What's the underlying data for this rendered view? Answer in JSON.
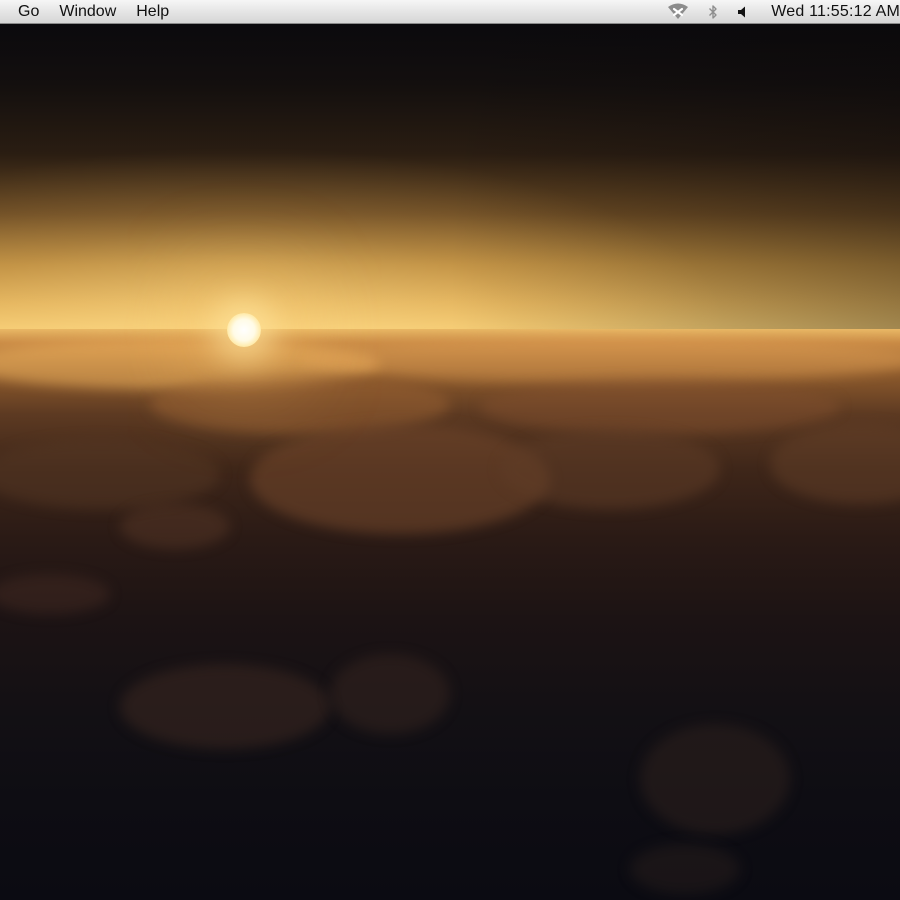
{
  "menubar": {
    "menus": [
      {
        "label": "Go"
      },
      {
        "label": "Window"
      },
      {
        "label": "Help"
      }
    ],
    "status_icons": [
      "wifi-icon",
      "bluetooth-icon",
      "volume-icon"
    ],
    "clock": "Wed 11:55:12 AM"
  },
  "wallpaper": {
    "description_icon": "sunset-above-clouds-wallpaper"
  }
}
